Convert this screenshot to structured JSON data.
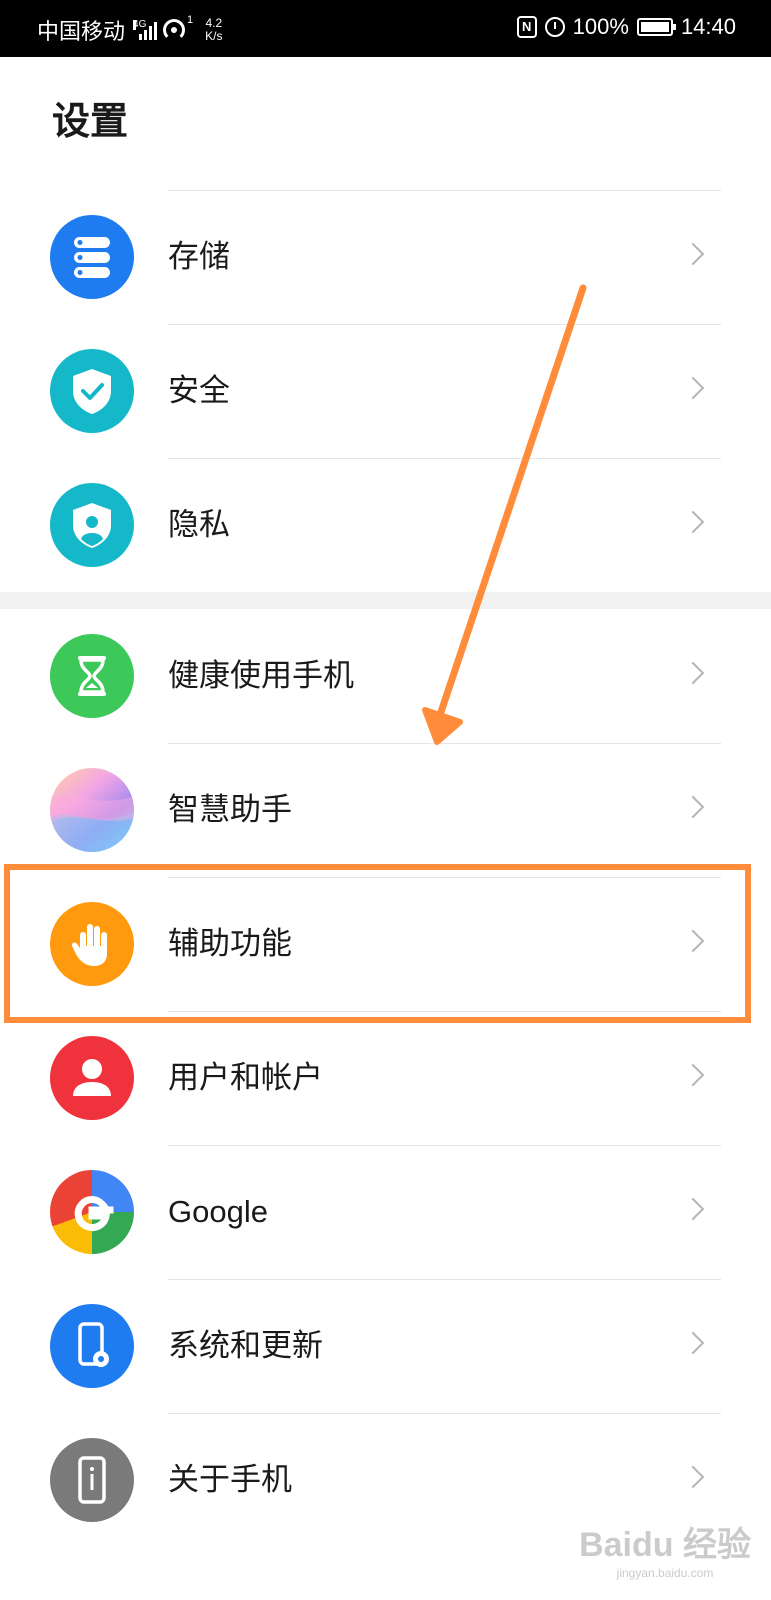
{
  "status_bar": {
    "carrier": "中国移动",
    "network_type": "4G",
    "wifi_badge": "1",
    "speed_value": "4.2",
    "speed_unit": "K/s",
    "nfc_label": "N",
    "battery_percent": "100%",
    "battery_level": 1.0,
    "time": "14:40"
  },
  "page": {
    "title": "设置"
  },
  "groups": [
    {
      "items": [
        {
          "label": "存储",
          "icon": "storage-icon",
          "color": "#1e7bf0"
        },
        {
          "label": "安全",
          "icon": "security-shield-icon",
          "color": "#14b8c8"
        },
        {
          "label": "隐私",
          "icon": "privacy-icon",
          "color": "#14b8c8"
        }
      ]
    },
    {
      "items": [
        {
          "label": "健康使用手机",
          "icon": "hourglass-icon",
          "color": "#3cc95a"
        },
        {
          "label": "智慧助手",
          "icon": "smart-assistant-icon",
          "color": "#e8a6d8"
        },
        {
          "label": "辅助功能",
          "icon": "hand-icon",
          "color": "#ff9a0e"
        },
        {
          "label": "用户和帐户",
          "icon": "user-icon",
          "color": "#f0323c"
        },
        {
          "label": "Google",
          "icon": "google-icon",
          "color": "#4285f4"
        },
        {
          "label": "系统和更新",
          "icon": "system-update-icon",
          "color": "#1e7bf0"
        },
        {
          "label": "关于手机",
          "icon": "about-phone-icon",
          "color": "#7a7a7a"
        }
      ]
    }
  ],
  "annotation": {
    "highlight_color": "#ff8c3a"
  },
  "watermark": {
    "brand": "Baidu 经验",
    "url": "jingyan.baidu.com"
  }
}
